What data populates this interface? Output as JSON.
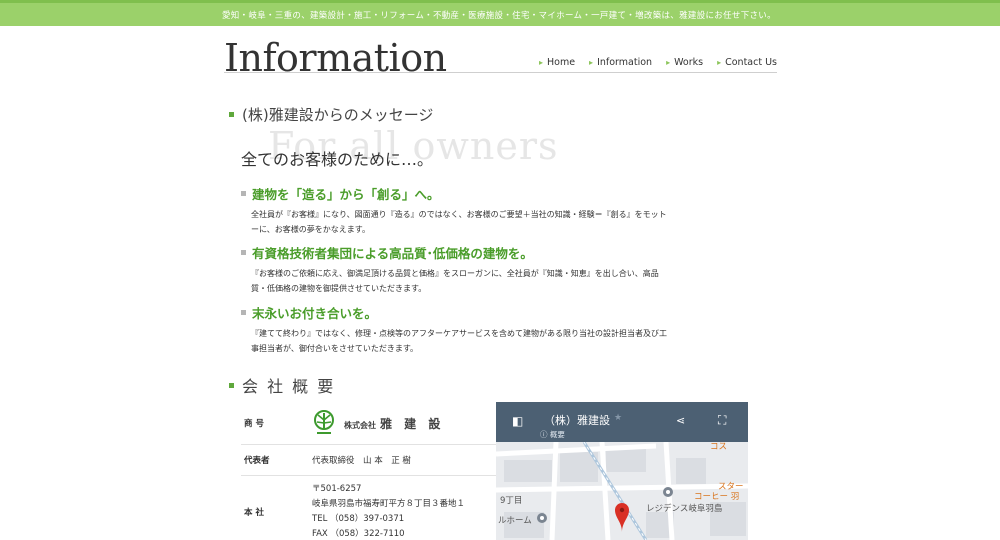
{
  "topbar": {
    "text": "愛知・岐阜・三重の、建築設計・施工・リフォーム・不動産・医療施設・住宅・マイホーム・一戸建て・増改築は、雅建設にお任せ下さい。",
    "color": "#9bd16a"
  },
  "page": {
    "title": "Information"
  },
  "nav": [
    {
      "label": "Home"
    },
    {
      "label": "Information"
    },
    {
      "label": "Works"
    },
    {
      "label": "Contact Us"
    }
  ],
  "message": {
    "heading": "(株)雅建設からのメッセージ",
    "ghost": "For all owners",
    "lead": "全てのお客様のために…。",
    "points": [
      {
        "title": "建物を「造る」から「創る」へ。",
        "body": "全社員が『お客様』になり、図面通り『造る』のではなく、お客様のご要望＋当社の知識・経験＝『創る』をモットーに、お客様の夢をかなえます。"
      },
      {
        "title": "有資格技術者集団による高品質･低価格の建物を。",
        "body": "『お客様のご依頼に応え、御満足頂ける品質と価格』をスローガンに、全社員が『知識・知恵』を出し合い、高品質・低価格の建物を御提供させていただきます。"
      },
      {
        "title": "末永いお付き合いを。",
        "body": "『建てて終わり』ではなく、修理・点検等のアフターケアサービスを含めて建物がある限り当社の設計担当者及び工事担当者が、御付合いをさせていただきます。"
      }
    ]
  },
  "company": {
    "heading": "会 社 概 要",
    "rows": {
      "name_label": "商 号",
      "logo_prefix": "株式会社",
      "logo_name": "雅 建 設",
      "rep_label": "代表者",
      "rep_value": "代表取締役　山 本　正 樹",
      "office_label": "本 社",
      "postal": "〒501-6257",
      "address": "岐阜県羽島市福寿町平方８丁目３番地１",
      "tel": "TEL （058）397-0371",
      "fax": "FAX （058）322-7110"
    }
  },
  "map": {
    "title": "（株）雅建設",
    "subtitle": "概要",
    "labels": {
      "a": "9丁目",
      "b": "ルホーム",
      "c": "レジデンス岐阜羽島",
      "d": "スター",
      "e": "コーヒー 羽",
      "f": "コス"
    }
  }
}
